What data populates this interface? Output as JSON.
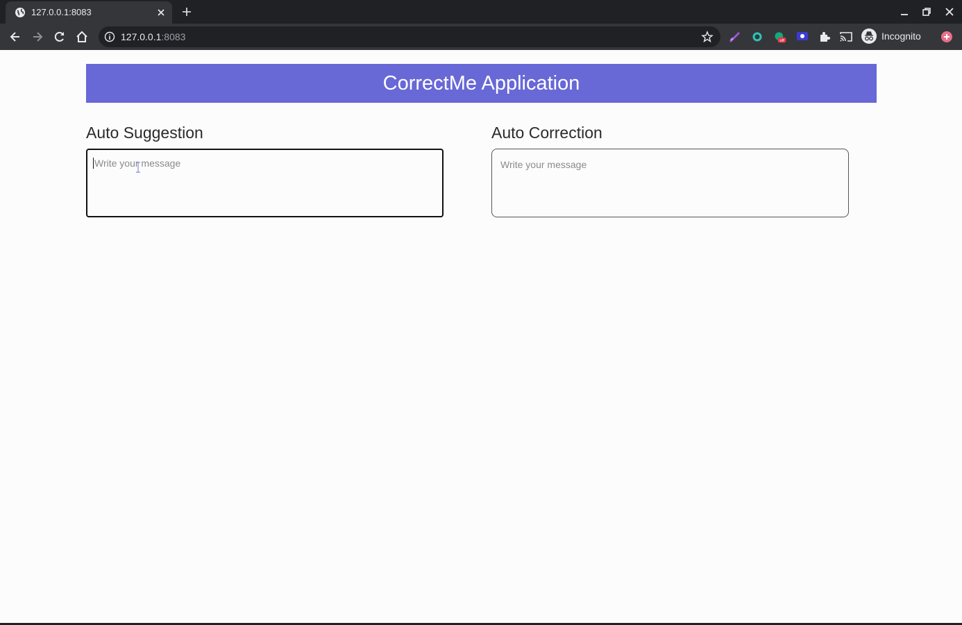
{
  "browser": {
    "tab_title": "127.0.0.1:8083",
    "url_host": "127.0.0.1",
    "url_port": ":8083",
    "profile_label": "Incognito",
    "icons": [
      "globe-icon",
      "close-icon",
      "plus-icon",
      "minimize-icon",
      "restore-icon",
      "back-icon",
      "forward-icon",
      "reload-icon",
      "home-icon",
      "info-icon",
      "star-icon",
      "extension-icon",
      "puzzle-icon",
      "cast-icon",
      "incognito-icon"
    ]
  },
  "page": {
    "title": "CorrectMe Application",
    "left_panel": {
      "heading": "Auto Suggestion",
      "placeholder": "Write your message"
    },
    "right_panel": {
      "heading": "Auto Correction",
      "placeholder": "Write your message"
    }
  },
  "colors": {
    "header_bg": "#6868d6",
    "chrome_dark": "#202124",
    "chrome_toolbar": "#35363a"
  }
}
